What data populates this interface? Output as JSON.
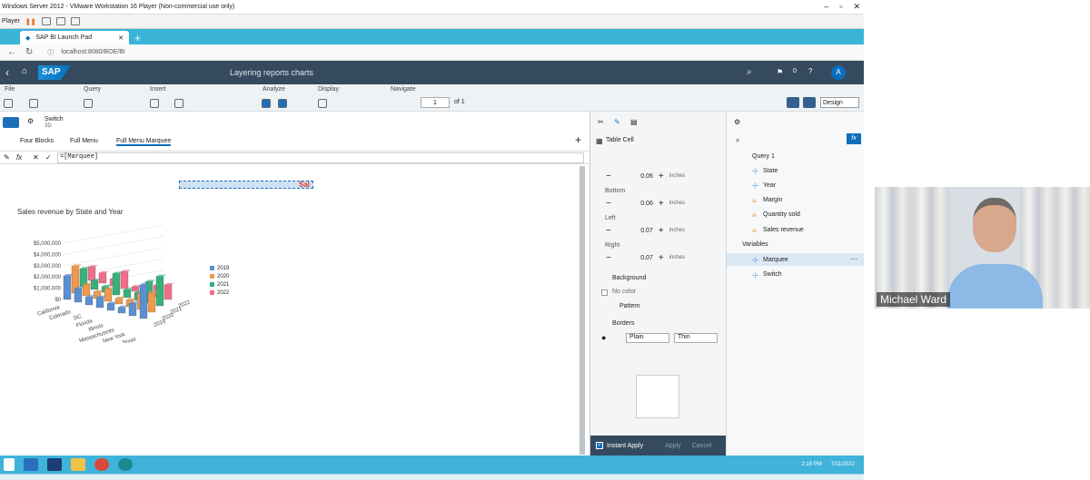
{
  "vm": {
    "title": "Windows Server 2012 - VMware Workstation 16 Player (Non-commercial use only)",
    "player": "Player"
  },
  "browser": {
    "tab": "SAP BI Launch Pad",
    "url": "localhost:8080/BOE/BI"
  },
  "sap": {
    "logo": "SAP",
    "doc_title": "Layering reports charts",
    "notif_count": "0",
    "avatar": "A"
  },
  "ribbon": {
    "groups": [
      "File",
      "Query",
      "Insert",
      "Analyze",
      "Display",
      "Navigate"
    ],
    "page": "1",
    "of": "of 1",
    "design": "Design"
  },
  "left": {
    "switch_label": "Switch",
    "switch_sub": "3D",
    "tabs": [
      "Four Blocks",
      "Full Menu",
      "Full Menu Marquee"
    ],
    "formula": "=[Marquee]",
    "cell_text": "Sal"
  },
  "chart_data": {
    "type": "bar",
    "title": "Sales revenue by State and Year",
    "categories": [
      "California",
      "Colorado",
      "DC",
      "Florida",
      "Illinois",
      "Massachusetts",
      "New York",
      "Texas"
    ],
    "yticks": [
      "$5,000,000",
      "$4,000,000",
      "$3,000,000",
      "$2,000,000",
      "$1,000,000",
      "$0"
    ],
    "depth": [
      "2019",
      "2020",
      "2021",
      "2022"
    ],
    "legend": [
      {
        "name": "2019",
        "color": "#5b8fd1"
      },
      {
        "name": "2020",
        "color": "#ef9a4a"
      },
      {
        "name": "2021",
        "color": "#37b07a"
      },
      {
        "name": "2022",
        "color": "#f06e8a"
      }
    ],
    "series": [
      {
        "name": "2019",
        "values": [
          2100000,
          1200000,
          700000,
          900000,
          600000,
          500000,
          1100000,
          3000000
        ]
      },
      {
        "name": "2020",
        "values": [
          2400000,
          1000000,
          600000,
          1100000,
          500000,
          600000,
          1400000,
          1700000
        ]
      },
      {
        "name": "2021",
        "values": [
          1600000,
          800000,
          500000,
          1900000,
          700000,
          700000,
          1900000,
          2600000
        ]
      },
      {
        "name": "2022",
        "values": [
          1200000,
          900000,
          600000,
          1500000,
          400000,
          500000,
          1000000,
          1300000
        ]
      }
    ]
  },
  "format": {
    "section": "Table Cell",
    "rows": [
      {
        "label": "",
        "value": "0.06",
        "unit": "inches"
      },
      {
        "label": "Bottom",
        "value": "0.06",
        "unit": "inches"
      },
      {
        "label": "Left",
        "value": "0.07",
        "unit": "inches"
      },
      {
        "label": "Right",
        "value": "0.07",
        "unit": "inches"
      }
    ],
    "background": "Background",
    "no_color": "No color",
    "pattern": "Pattern",
    "borders": "Borders",
    "style": "Plain",
    "width": "Thin",
    "instant_apply": "Instant Apply",
    "apply": "Apply",
    "cancel": "Cancel"
  },
  "objects": {
    "query": "Query 1",
    "dims": [
      "State",
      "Year"
    ],
    "measures": [
      "Margin",
      "Quantity sold",
      "Sales revenue"
    ],
    "variables_title": "Variables",
    "variables": [
      "Marquee",
      "Switch"
    ]
  },
  "taskbar": {
    "time": "2:18 PM",
    "date": "7/11/2022"
  },
  "video": {
    "name": "Michael Ward"
  }
}
